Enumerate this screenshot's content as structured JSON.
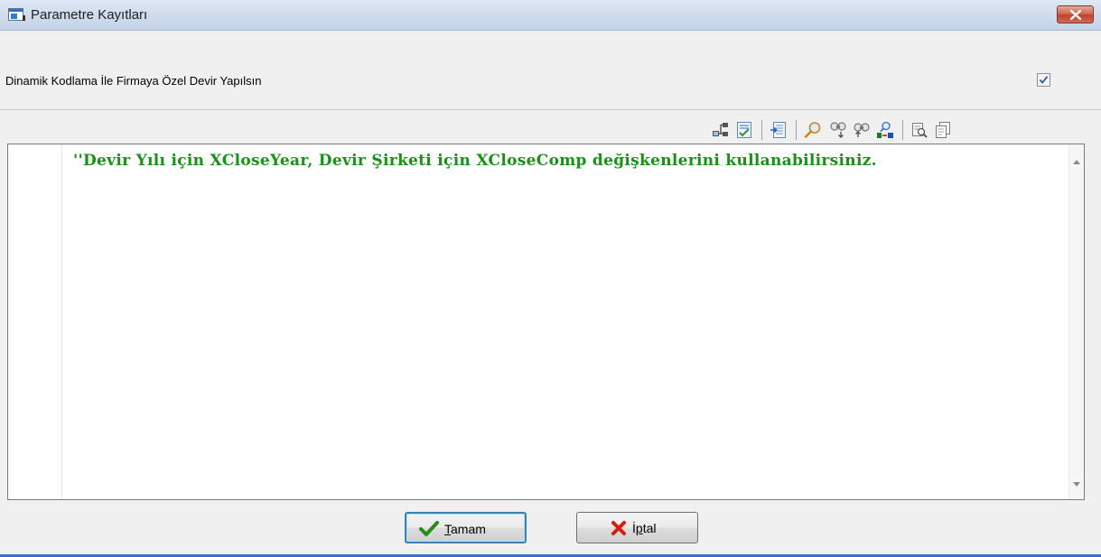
{
  "window": {
    "title": "Parametre Kayıtları",
    "title_icon": "window-app-icon",
    "close_icon": "close-icon",
    "colors": {
      "close_button": "#c7432e",
      "chrome": "#f0f0f0"
    }
  },
  "parameter": {
    "label": "Dinamik Kodlama İle Firmaya Özel Devir Yapılsın",
    "checked": true
  },
  "toolbar": {
    "icons": [
      "hierarchy-icon",
      "checklist-icon",
      "insert-text-icon",
      "find-icon",
      "find-next-icon",
      "find-previous-icon",
      "replace-icon",
      "print-preview-icon",
      "page-copy-icon"
    ]
  },
  "editor": {
    "code_line": "''Devir Yılı için XCloseYear, Devir Şirketi için XCloseComp değişkenlerini kullanabilirsiniz.",
    "colors": {
      "comment_text": "#179217"
    }
  },
  "buttons": {
    "ok": {
      "label_first": "T",
      "label_rest": "amam",
      "icon": "checkmark-icon"
    },
    "cancel": {
      "label_first": "İ",
      "label_mid": "p",
      "label_rest": "tal",
      "icon": "x-mark-icon"
    }
  }
}
